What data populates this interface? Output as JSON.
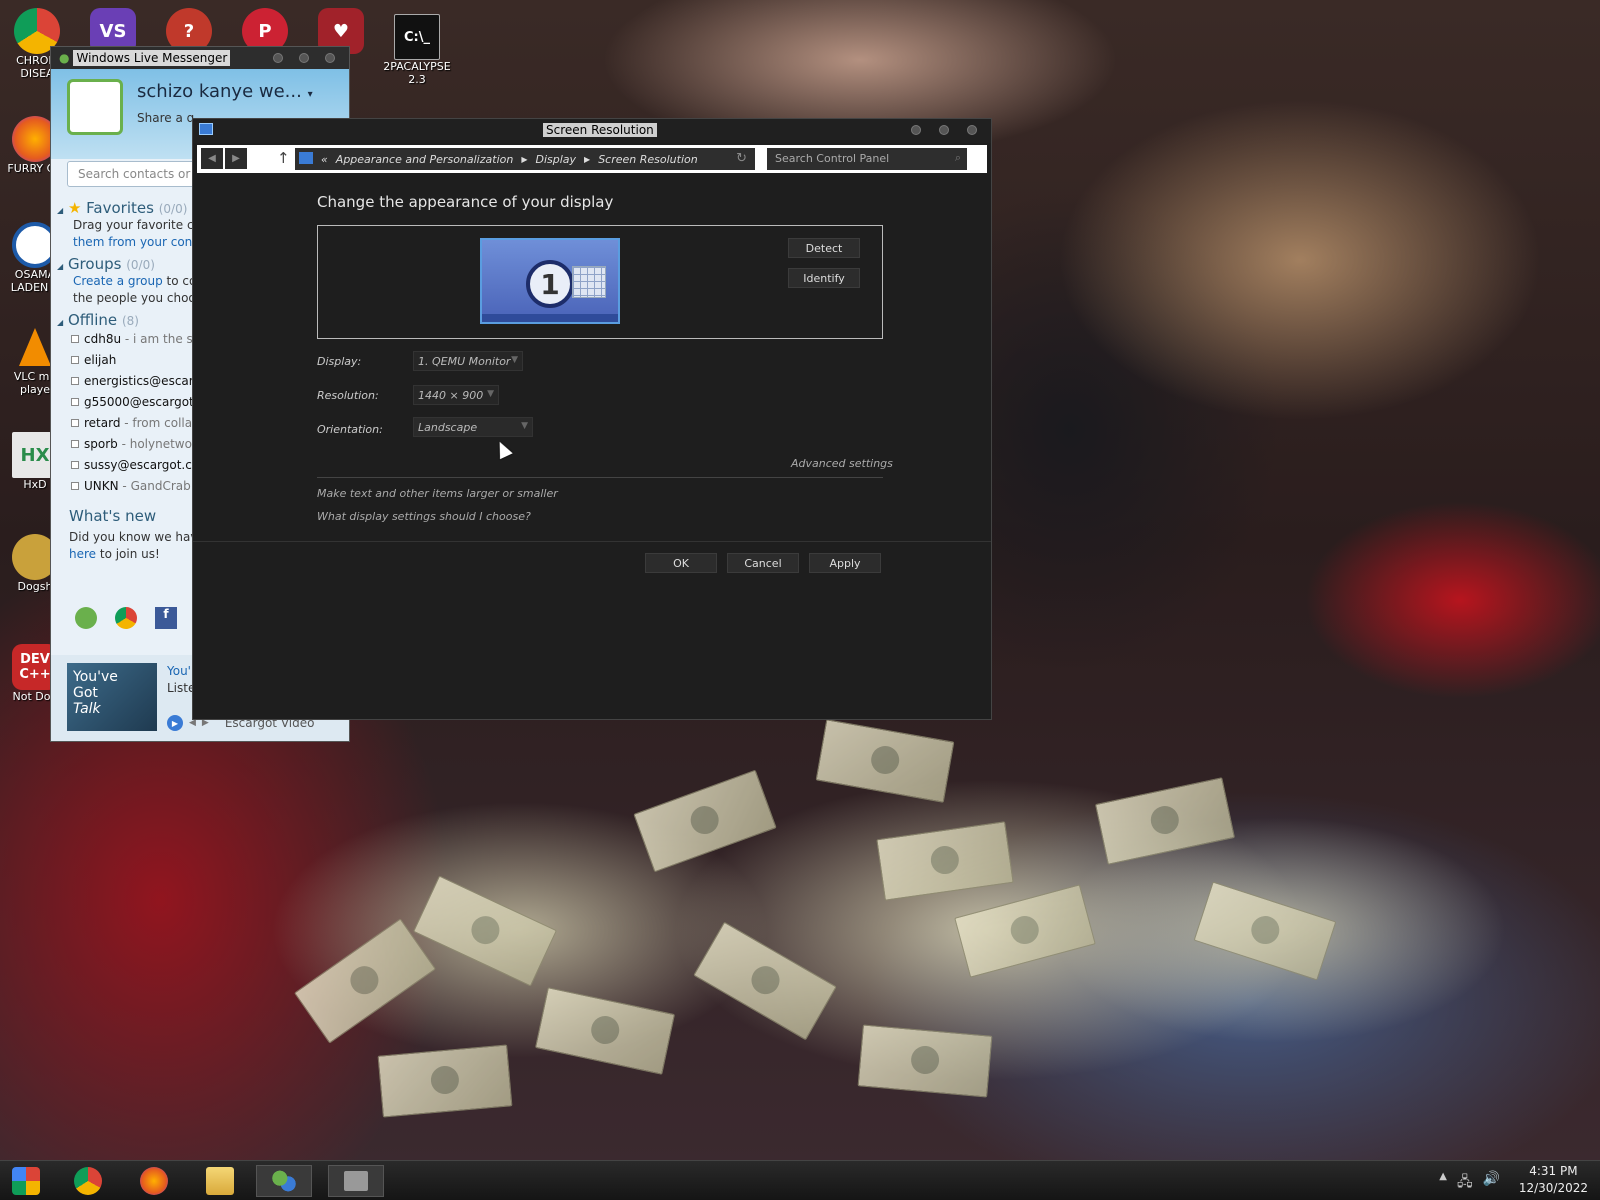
{
  "desktop": {
    "icons": [
      {
        "label": "CHROM\nDISEA"
      },
      {
        "label": ""
      },
      {
        "label": ""
      },
      {
        "label": ""
      },
      {
        "label": ""
      },
      {
        "label": "2PACALYPSE\n2.3"
      },
      {
        "label": "FURRY CH"
      },
      {
        "label": "OSAMA\nLADEN B"
      },
      {
        "label": "VLC me\nplaye"
      },
      {
        "label": "HxD"
      },
      {
        "label": "Dogsh"
      },
      {
        "label": "Not Dog"
      }
    ]
  },
  "messenger": {
    "title": "Windows Live Messenger",
    "display_name": "schizo kanye we...",
    "status_prompt": "Share a q",
    "search_placeholder": "Search contacts or th",
    "favorites": {
      "label": "Favorites",
      "count": "(0/0)",
      "desc_1": "Drag your favorite co",
      "desc_2": "them from your conta"
    },
    "groups": {
      "label": "Groups",
      "count": "(0/0)",
      "link": "Create a group",
      "desc_1": " to co",
      "desc_2": "the people you choose"
    },
    "offline": {
      "label": "Offline",
      "count": "(8)"
    },
    "contacts": [
      {
        "name": "cdh8u",
        "msg": " - i am the se"
      },
      {
        "name": "elijah",
        "msg": ""
      },
      {
        "name": "energistics@escarg",
        "msg": ""
      },
      {
        "name": "g55000@escargot.",
        "msg": ""
      },
      {
        "name": "retard",
        "msg": " - from collab"
      },
      {
        "name": "sporb",
        "msg": " - holynetwork"
      },
      {
        "name": "sussy@escargot.ch",
        "msg": ""
      },
      {
        "name": "UNKN",
        "msg": " - GandCrab A"
      }
    ],
    "whats_new": "What's new",
    "news_1": "Did you know we have",
    "news_link": "here",
    "news_2": " to join us!",
    "ad_text_1": "You've",
    "ad_text_2": "Got",
    "ad_text_3": "Talk",
    "ad_side_1": "You'",
    "ad_side_2": "Liste",
    "video_label": "Escargot Video"
  },
  "screen_resolution": {
    "title": "Screen Resolution",
    "breadcrumb": [
      "Appearance and Personalization",
      "Display",
      "Screen Resolution"
    ],
    "search_placeholder": "Search Control Panel",
    "heading": "Change the appearance of your display",
    "monitor_number": "1",
    "detect_label": "Detect",
    "identify_label": "Identify",
    "display_label": "Display:",
    "display_value": "1. QEMU Monitor",
    "resolution_label": "Resolution:",
    "resolution_value": "1440 × 900",
    "orientation_label": "Orientation:",
    "orientation_value": "Landscape",
    "advanced_link": "Advanced settings",
    "link_text_size": "Make text and other items larger or smaller",
    "link_help": "What display settings should I choose?",
    "ok_label": "OK",
    "cancel_label": "Cancel",
    "apply_label": "Apply"
  },
  "taskbar": {
    "time": "4:31 PM",
    "date": "12/30/2022"
  },
  "colors": {
    "accent_blue": "#3a7bd5",
    "window_bg": "#1e1e1e",
    "messenger_bg": "#e9f1f8"
  }
}
